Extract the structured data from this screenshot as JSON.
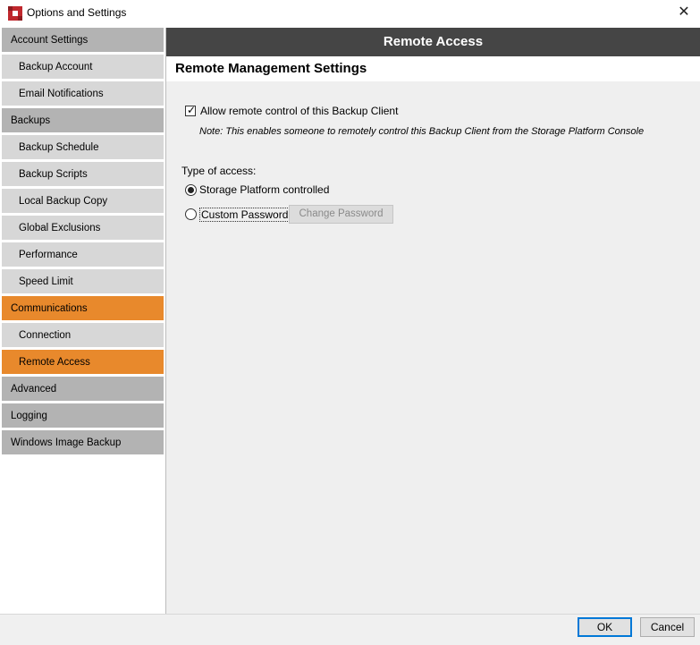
{
  "window": {
    "title": "Options and Settings",
    "app_icon": "app-logo-icon",
    "close_glyph": "✕"
  },
  "sidebar": {
    "items": [
      {
        "label": "Account Settings",
        "kind": "category",
        "active": false
      },
      {
        "label": "Backup Account",
        "kind": "sub",
        "active": false
      },
      {
        "label": "Email Notifications",
        "kind": "sub",
        "active": false
      },
      {
        "label": "Backups",
        "kind": "category",
        "active": false
      },
      {
        "label": "Backup Schedule",
        "kind": "sub",
        "active": false
      },
      {
        "label": "Backup Scripts",
        "kind": "sub",
        "active": false
      },
      {
        "label": "Local Backup Copy",
        "kind": "sub",
        "active": false
      },
      {
        "label": "Global Exclusions",
        "kind": "sub",
        "active": false
      },
      {
        "label": "Performance",
        "kind": "sub",
        "active": false
      },
      {
        "label": "Speed Limit",
        "kind": "sub",
        "active": false
      },
      {
        "label": "Communications",
        "kind": "category",
        "active": true
      },
      {
        "label": "Connection",
        "kind": "sub",
        "active": false
      },
      {
        "label": "Remote Access",
        "kind": "sub",
        "active": true
      },
      {
        "label": "Advanced",
        "kind": "category",
        "active": false
      },
      {
        "label": "Logging",
        "kind": "category",
        "active": false
      },
      {
        "label": "Windows Image Backup",
        "kind": "category",
        "active": false
      }
    ]
  },
  "main": {
    "header": "Remote Access",
    "section_title": "Remote Management Settings",
    "allow_remote": {
      "label": "Allow remote control of this Backup Client",
      "checked": true
    },
    "note": "Note: This enables someone to remotely control this Backup Client from the Storage Platform Console",
    "access_label": "Type of access:",
    "options": [
      {
        "label": "Storage Platform controlled",
        "selected": true
      },
      {
        "label": "Custom Password:",
        "selected": false
      }
    ],
    "change_password_label": "Change Password"
  },
  "footer": {
    "ok_label": "OK",
    "cancel_label": "Cancel"
  },
  "colors": {
    "accent_active": "#e8892c",
    "header_bg": "#454545",
    "category_bg": "#b3b3b3",
    "sub_bg": "#d7d7d7"
  }
}
